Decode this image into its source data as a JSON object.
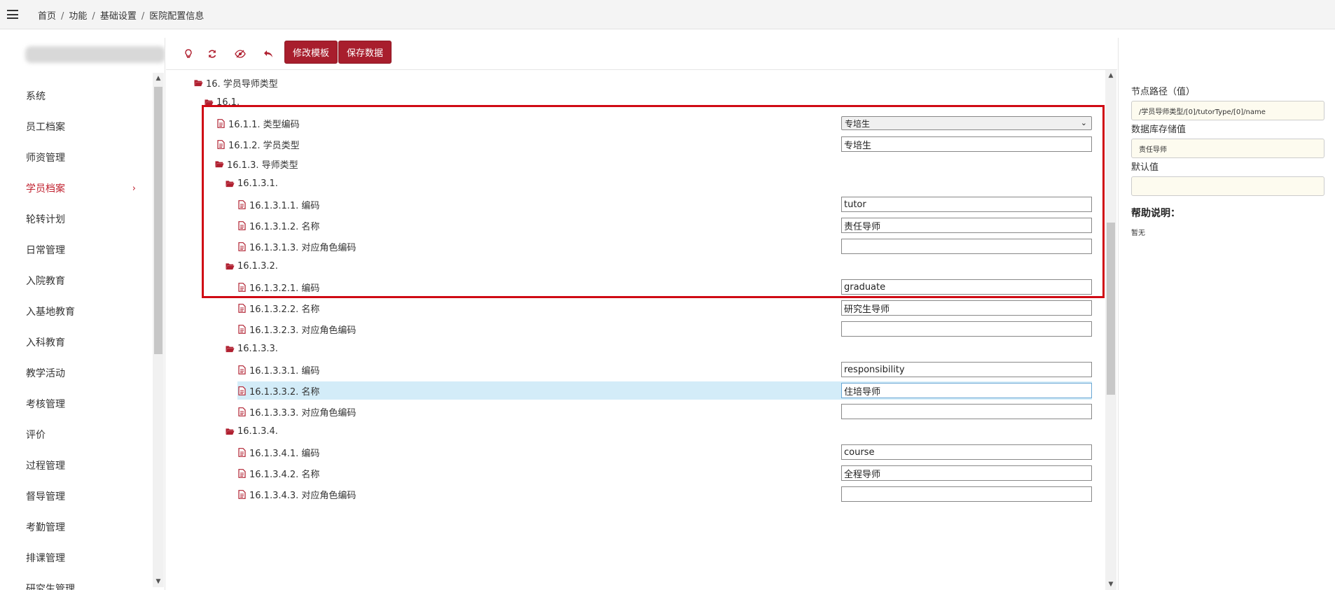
{
  "breadcrumb": {
    "items": [
      "首页",
      "功能",
      "基础设置",
      "医院配置信息"
    ],
    "separator": "/"
  },
  "sidebar": {
    "items": [
      {
        "label": "系统"
      },
      {
        "label": "员工档案"
      },
      {
        "label": "师资管理"
      },
      {
        "label": "学员档案",
        "active": true,
        "chevron": "›"
      },
      {
        "label": "轮转计划"
      },
      {
        "label": "日常管理"
      },
      {
        "label": "入院教育"
      },
      {
        "label": "入基地教育"
      },
      {
        "label": "入科教育"
      },
      {
        "label": "教学活动"
      },
      {
        "label": "考核管理"
      },
      {
        "label": "评价"
      },
      {
        "label": "过程管理"
      },
      {
        "label": "督导管理"
      },
      {
        "label": "考勤管理"
      },
      {
        "label": "排课管理"
      },
      {
        "label": "研究生管理"
      }
    ]
  },
  "toolbar": {
    "icons": [
      "lightbulb-icon",
      "refresh-icon",
      "eye-slash-icon",
      "undo-icon"
    ],
    "edit_template_label": "修改模板",
    "save_data_label": "保存数据",
    "accent": "#a81e2d"
  },
  "tree": {
    "nodes": [
      {
        "label": "16. 学员导师类型",
        "type": "folder"
      },
      {
        "label": "16.1.",
        "type": "folder"
      },
      {
        "label": "16.1.1. 类型编码",
        "type": "file",
        "select": "专培生"
      },
      {
        "label": "16.1.2. 学员类型",
        "type": "file",
        "value": "专培生"
      },
      {
        "label": "16.1.3. 导师类型",
        "type": "folder"
      },
      {
        "label": "16.1.3.1.",
        "type": "folder"
      },
      {
        "label": "16.1.3.1.1. 编码",
        "type": "file",
        "value": "tutor"
      },
      {
        "label": "16.1.3.1.2. 名称",
        "type": "file",
        "value": "责任导师"
      },
      {
        "label": "16.1.3.1.3. 对应角色编码",
        "type": "file",
        "value": ""
      },
      {
        "label": "16.1.3.2.",
        "type": "folder"
      },
      {
        "label": "16.1.3.2.1. 编码",
        "type": "file",
        "value": "graduate"
      },
      {
        "label": "16.1.3.2.2. 名称",
        "type": "file",
        "value": "研究生导师"
      },
      {
        "label": "16.1.3.2.3. 对应角色编码",
        "type": "file",
        "value": ""
      },
      {
        "label": "16.1.3.3.",
        "type": "folder"
      },
      {
        "label": "16.1.3.3.1. 编码",
        "type": "file",
        "value": "responsibility"
      },
      {
        "label": "16.1.3.3.2. 名称",
        "type": "file",
        "value": "住培导师",
        "selected": true
      },
      {
        "label": "16.1.3.3.3. 对应角色编码",
        "type": "file",
        "value": ""
      },
      {
        "label": "16.1.3.4.",
        "type": "folder"
      },
      {
        "label": "16.1.3.4.1. 编码",
        "type": "file",
        "value": "course"
      },
      {
        "label": "16.1.3.4.2. 名称",
        "type": "file",
        "value": "全程导师"
      },
      {
        "label": "16.1.3.4.3. 对应角色编码",
        "type": "file",
        "value": ""
      }
    ],
    "icon_color": "#b02030",
    "selected_row_color": "#d3ecf8",
    "highlight_border_color": "#d00a14"
  },
  "right_panel": {
    "path_label": "节点路径（值）",
    "path_value": "/学员导师类型/[0]/tutorType/[0]/name",
    "db_value_label": "数据库存储值",
    "db_value": "责任导师",
    "default_label": "默认值",
    "default_value": "",
    "help_title": "帮助说明：",
    "help_text": "暂无",
    "field_bg": "#fdfbef"
  }
}
